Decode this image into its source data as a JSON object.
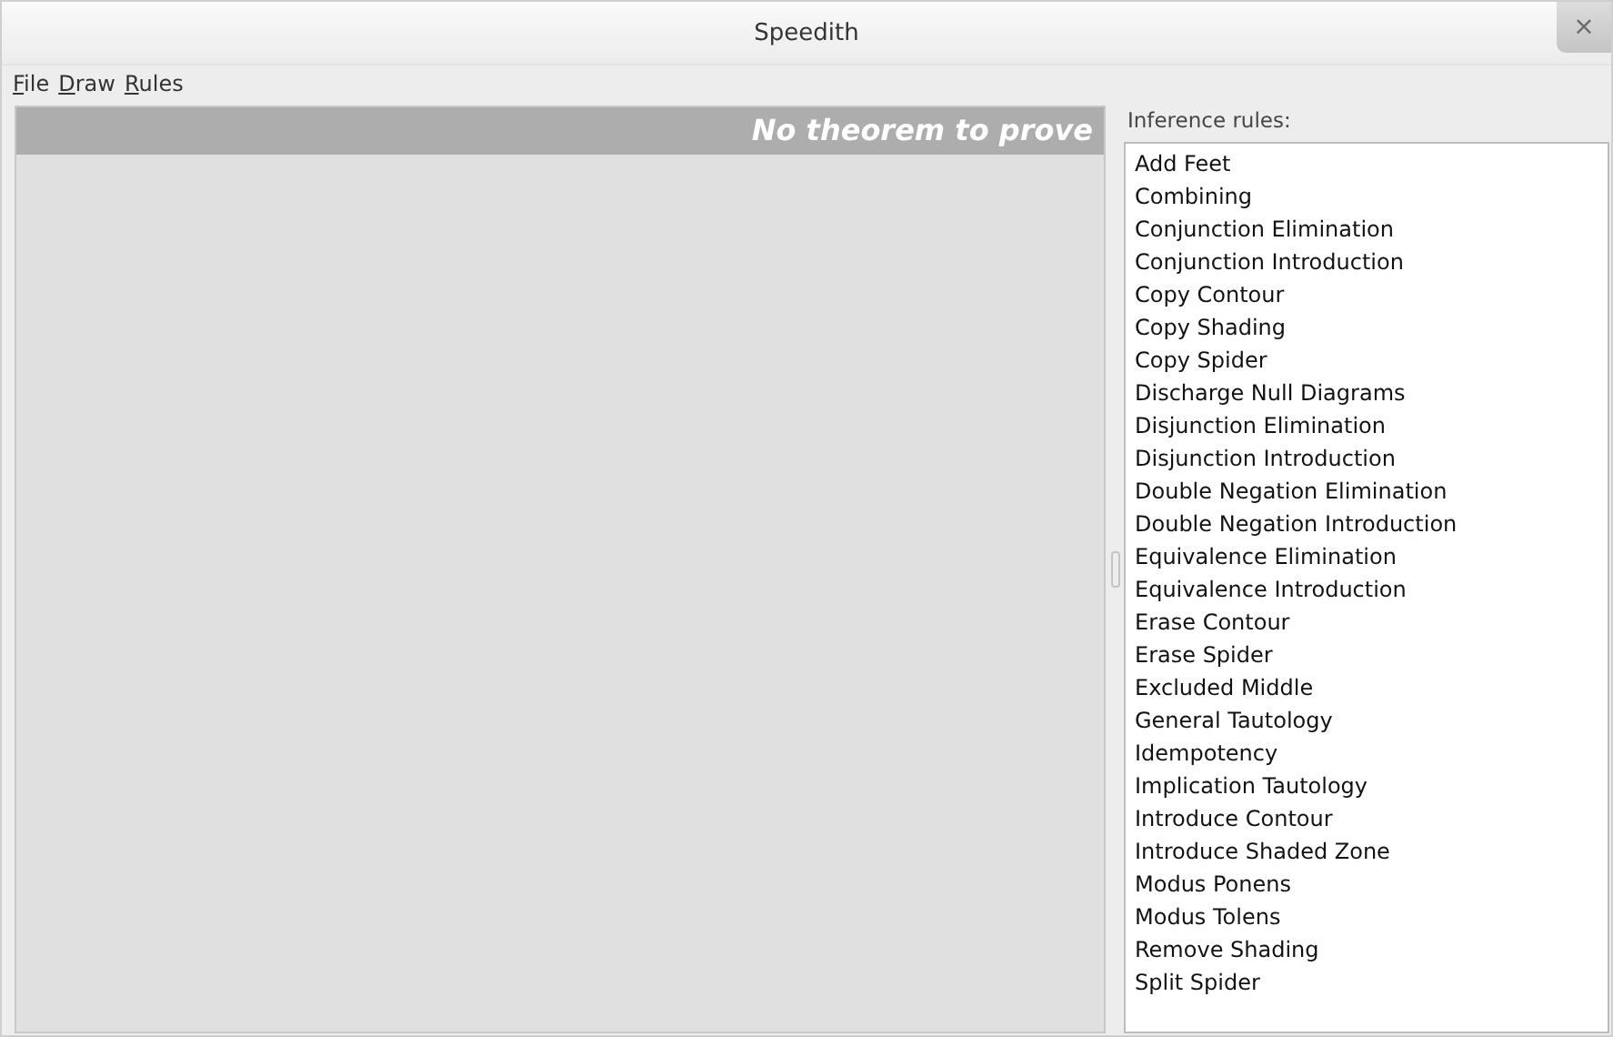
{
  "window": {
    "title": "Speedith",
    "close": "×"
  },
  "menu": [
    "File",
    "Draw",
    "Rules"
  ],
  "proof_panel": {
    "header": "No theorem to prove"
  },
  "rules_panel": {
    "label": "Inference rules:",
    "items": [
      "Add Feet",
      "Combining",
      "Conjunction Elimination",
      "Conjunction Introduction",
      "Copy Contour",
      "Copy Shading",
      "Copy Spider",
      "Discharge Null Diagrams",
      "Disjunction Elimination",
      "Disjunction Introduction",
      "Double Negation Elimination",
      "Double Negation Introduction",
      "Equivalence Elimination",
      "Equivalence Introduction",
      "Erase Contour",
      "Erase Spider",
      "Excluded Middle",
      "General Tautology",
      "Idempotency",
      "Implication Tautology",
      "Introduce Contour",
      "Introduce Shaded Zone",
      "Modus Ponens",
      "Modus Tolens",
      "Remove Shading",
      "Split Spider"
    ]
  }
}
